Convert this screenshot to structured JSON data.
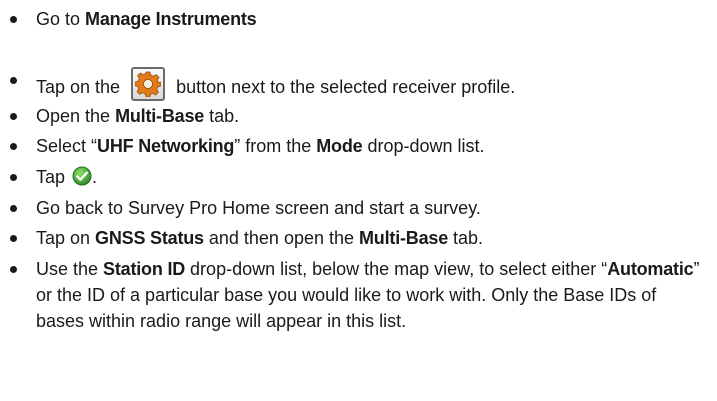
{
  "steps": [
    {
      "pre": "Go to ",
      "b1": "Manage Instruments"
    },
    {
      "pre": "Tap on the ",
      "icon": "gear-settings-icon",
      "post": " button next to the selected receiver profile."
    },
    {
      "pre": "Open the ",
      "b1": "Multi-Base",
      "post": " tab."
    },
    {
      "pre": "Select “",
      "b1": "UHF Networking",
      "mid": "” from the ",
      "b2": "Mode",
      "post": " drop-down list."
    },
    {
      "pre": "Tap ",
      "icon": "check-ok-icon",
      "post": "."
    },
    {
      "pre": "Go back to Survey Pro Home screen and start a survey."
    },
    {
      "pre": "Tap on ",
      "b1": "GNSS Status",
      "mid": " and then open the ",
      "b2": "Multi-Base",
      "post": " tab."
    },
    {
      "pre": "Use the ",
      "b1": "Station ID",
      "mid": " drop-down list, below the map view, to select either “",
      "b2": "Automatic",
      "post": "” or the ID of a particular base you would like to work with. Only the Base IDs of bases within radio range will appear in this list."
    }
  ],
  "colors": {
    "text": "#1a1a1a",
    "gear_orange": "#e07a1a",
    "check_green": "#3aa53a"
  }
}
